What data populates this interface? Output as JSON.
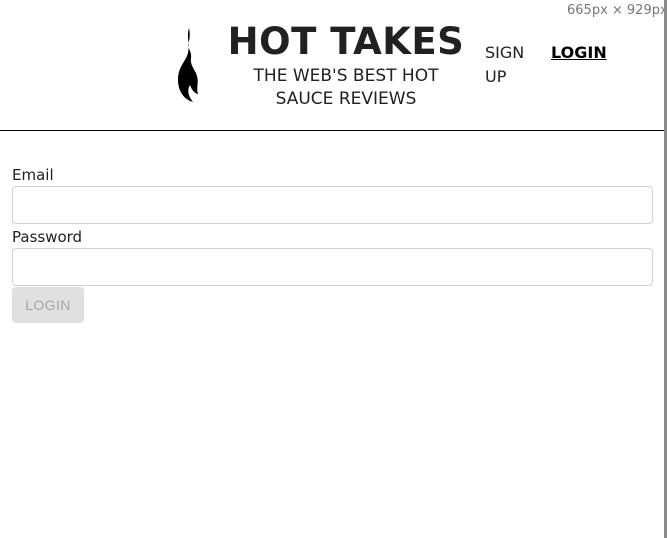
{
  "devtools": {
    "dimensions": "665px × 929px"
  },
  "header": {
    "logo_icon": "flame-icon",
    "title": "HOT TAKES",
    "subtitle": "THE WEB'S BEST HOT SAUCE REVIEWS",
    "nav": {
      "signup_label": "SIGN UP",
      "login_label": "LOGIN"
    }
  },
  "form": {
    "email_label": "Email",
    "email_value": "",
    "password_label": "Password",
    "password_value": "",
    "submit_label": "LOGIN",
    "submit_disabled": true
  },
  "colors": {
    "text": "#212121",
    "divider": "#000000",
    "input_border": "#cfcfcf",
    "button_bg_disabled": "#e0e0e0",
    "button_text_disabled": "#a6a6a6"
  }
}
